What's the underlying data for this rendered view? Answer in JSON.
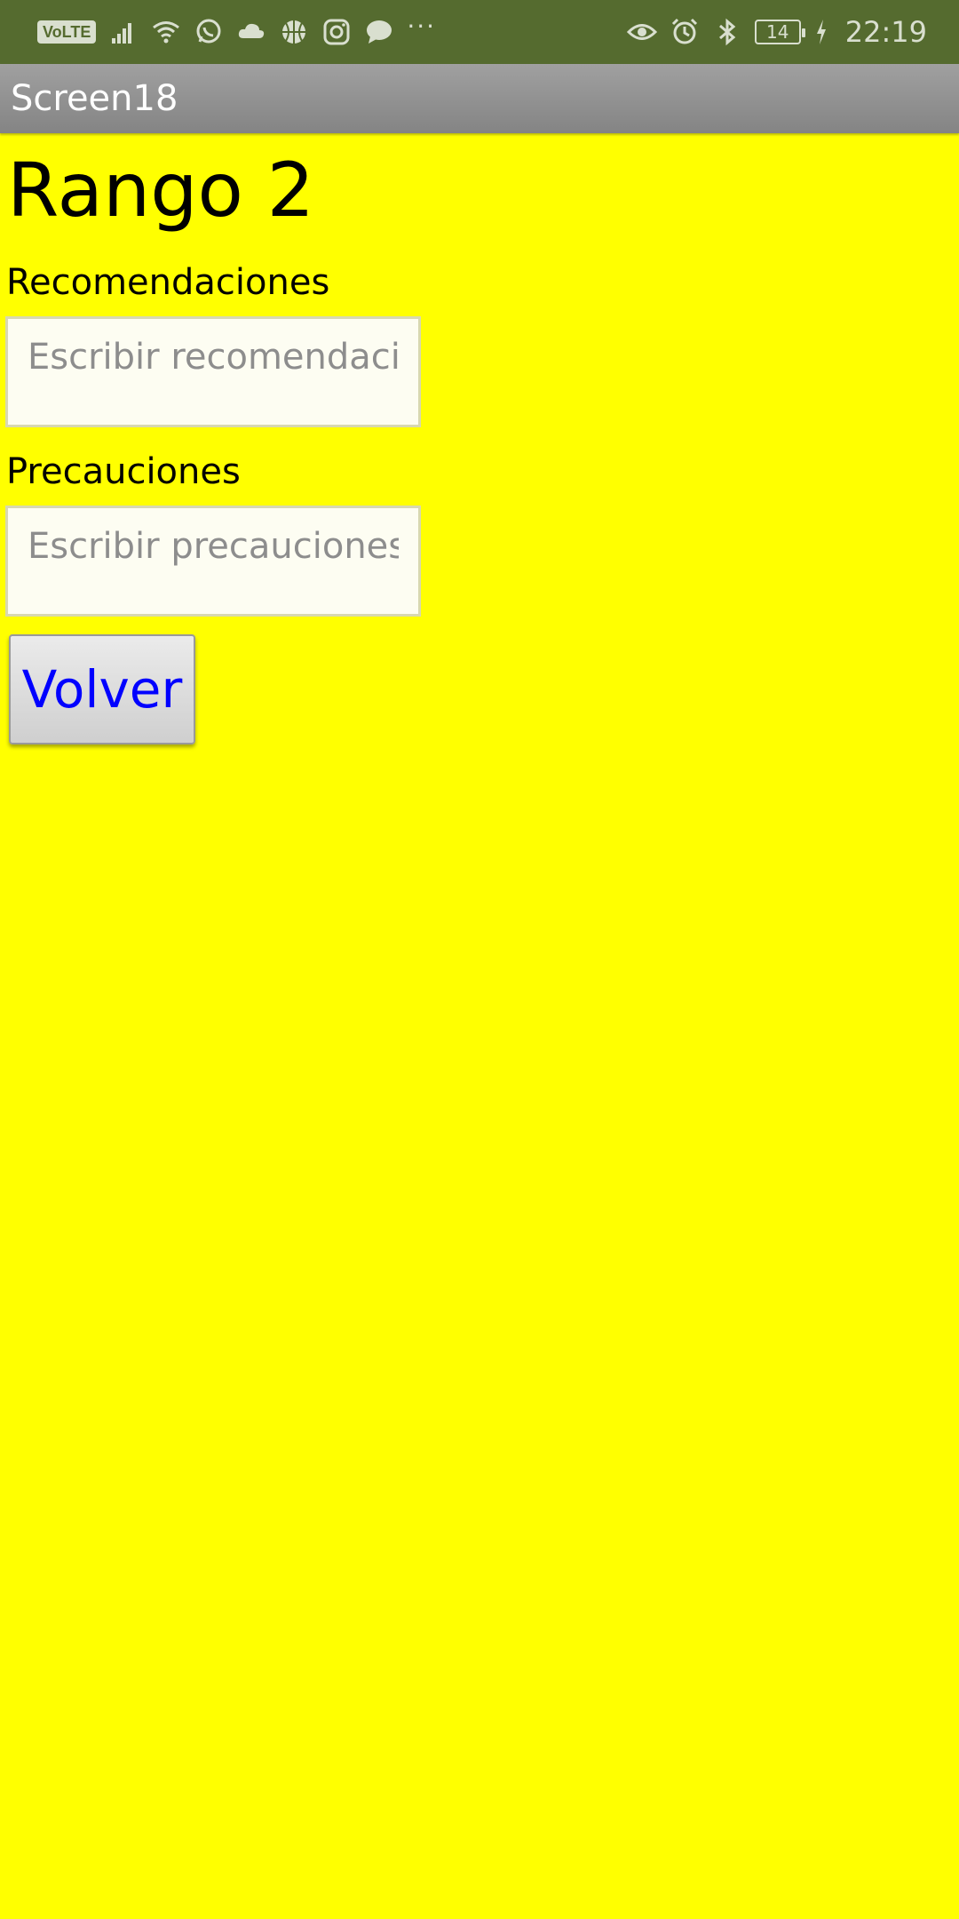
{
  "status_bar": {
    "network_badge": "VoLTE",
    "left_icons": [
      "signal-icon",
      "wifi-icon",
      "whatsapp-icon",
      "cloud-icon",
      "basketball-icon",
      "instagram-icon",
      "chat-bubble-icon"
    ],
    "overflow": "···",
    "right_icons": [
      "eye-icon",
      "alarm-icon",
      "bluetooth-icon"
    ],
    "battery_level": "14",
    "time": "22:19",
    "background_color": "#556b2f"
  },
  "title_bar": {
    "title": "Screen18"
  },
  "content": {
    "heading": "Rango 2",
    "recommendations_label": "Recomendaciones",
    "recommendations_placeholder": "Escribir recomendaciones",
    "recommendations_value": "",
    "precautions_label": "Precauciones",
    "precautions_placeholder": "Escribir precauciones p",
    "precautions_value": "",
    "back_button_label": "Volver",
    "background_color": "#ffff00",
    "button_text_color": "#0000ff"
  }
}
